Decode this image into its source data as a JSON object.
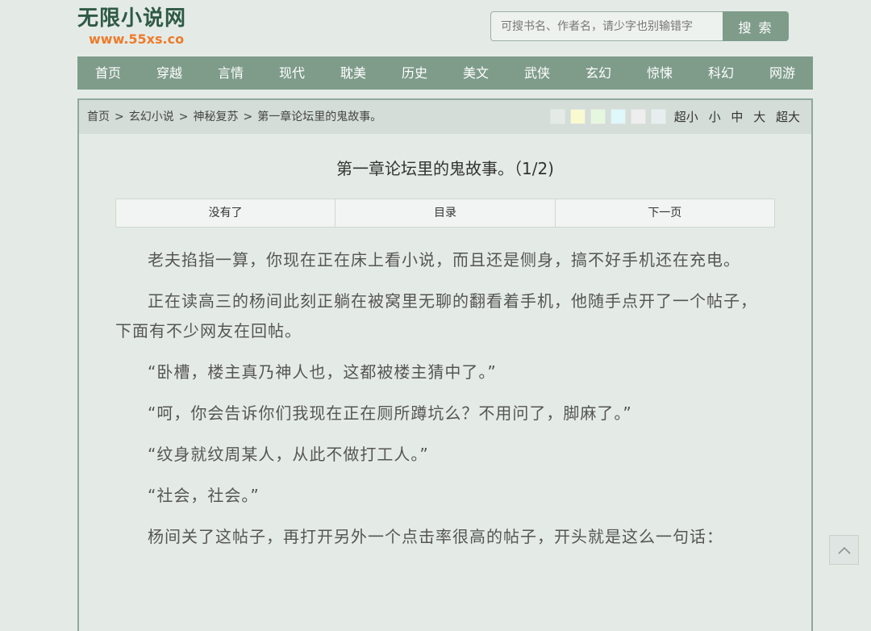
{
  "logo": {
    "title": "无限小说网",
    "url": "www.55xs.co"
  },
  "search": {
    "placeholder": "可搜书名、作者名，请少字也别输错字",
    "button_label": "搜 索"
  },
  "nav": {
    "items": [
      "首页",
      "穿越",
      "言情",
      "现代",
      "耽美",
      "历史",
      "美文",
      "武侠",
      "玄幻",
      "惊悚",
      "科幻",
      "网游"
    ]
  },
  "breadcrumb": {
    "home": "首页",
    "category": "玄幻小说",
    "book": "神秘复苏",
    "chapter": "第一章论坛里的鬼故事。"
  },
  "theme_swatches": [
    "#e4ebe7",
    "#fafad0",
    "#e6f7df",
    "#def8fb",
    "#eeeeee",
    "#e8eef0"
  ],
  "font_sizes": [
    "超小",
    "小",
    "中",
    "大",
    "超大"
  ],
  "chapter": {
    "title": "第一章论坛里的鬼故事。（1/2)",
    "prev_label": "没有了",
    "toc_label": "目录",
    "next_label": "下一页",
    "paragraphs": [
      "老夫掐指一算，你现在正在床上看小说，而且还是侧身，搞不好手机还在充电。",
      "正在读高三的杨间此刻正躺在被窝里无聊的翻看着手机，他随手点开了一个帖子，下面有不少网友在回帖。",
      "“卧槽，楼主真乃神人也，这都被楼主猜中了。”",
      "“呵，你会告诉你们我现在正在厕所蹲坑么？不用问了，脚麻了。”",
      "“纹身就纹周某人，从此不做打工人。”",
      "“社会，社会。”",
      "杨间关了这帖子，再打开另外一个点击率很高的帖子，开头就是这么一句话："
    ]
  },
  "colors": {
    "accent": "#7f9c8b",
    "logo_green": "#2f5a45",
    "logo_orange": "#f07a2a"
  }
}
